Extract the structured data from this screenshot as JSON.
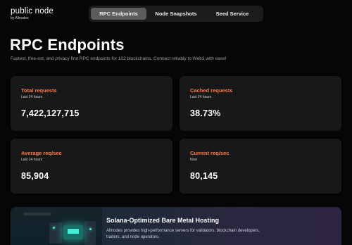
{
  "header": {
    "logo_title": "public node",
    "logo_sub": "by Allnodes",
    "nav": [
      {
        "label": "RPC Endpoints",
        "active": true
      },
      {
        "label": "Node Snapshots",
        "active": false
      },
      {
        "label": "Seed Service",
        "active": false
      }
    ]
  },
  "main": {
    "title": "RPC Endpoints",
    "subtitle": "Fastest, free-est, and privacy first RPC endpoints for 102 blockchains. Connect reliably to Web3 with ease!",
    "stats": [
      {
        "label": "Total requests",
        "period": "Last 24 hours",
        "value": "7,422,127,715"
      },
      {
        "label": "Cached requests",
        "period": "Last 24 hours",
        "value": "38.73%"
      },
      {
        "label": "Average req/sec",
        "period": "Last 24 hours",
        "value": "85,904"
      },
      {
        "label": "Current req/sec",
        "period": "Now",
        "value": "80,145"
      }
    ]
  },
  "promo": {
    "title": "Solana-Optimized Bare Metal Hosting",
    "text": "Allnodes provides high-performance servers for validators, blockchain developers, traders, and node operators."
  },
  "colors": {
    "accent": "#ff7a45",
    "card_bg": "#181818",
    "page_bg": "#060606",
    "nav_active": "#5c5c5c"
  }
}
